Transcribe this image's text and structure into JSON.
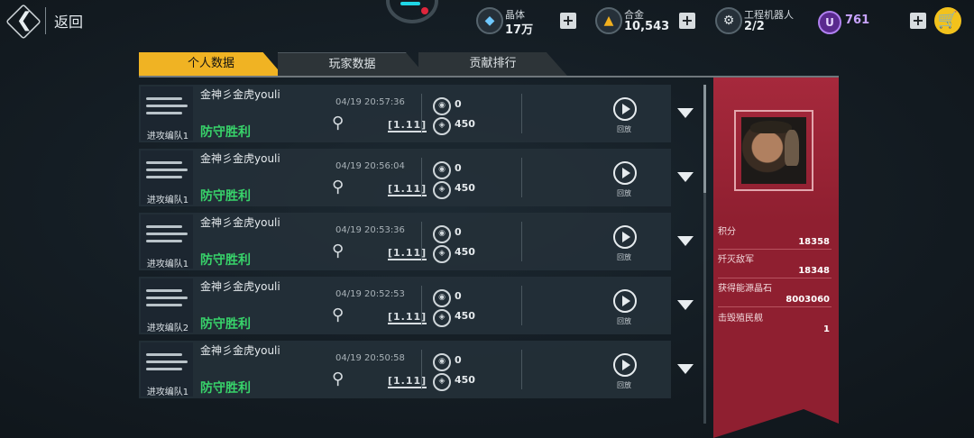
{
  "topbar": {
    "back_label": "返回",
    "resources": [
      {
        "name": "晶体",
        "value": "17万",
        "icon": "crystal-icon"
      },
      {
        "name": "合金",
        "value": "10,543",
        "icon": "alloy-icon"
      },
      {
        "name": "工程机器人",
        "value": "2/2",
        "icon": "robot-icon"
      }
    ],
    "premium_value": "761",
    "premium_icon_letter": "U"
  },
  "tabs": [
    {
      "label": "个人数据",
      "active": true
    },
    {
      "label": "玩家数据",
      "active": false
    },
    {
      "label": "贡献排行",
      "active": false
    }
  ],
  "records": [
    {
      "unit": "进攻编队1",
      "player": "金神彡金虎youli",
      "time": "04/19 20:57:36",
      "result": "防守胜利",
      "stat1": "0",
      "stat2": "450",
      "level_tag": "[1.11]",
      "replay_label": "回放"
    },
    {
      "unit": "进攻编队1",
      "player": "金神彡金虎youli",
      "time": "04/19 20:56:04",
      "result": "防守胜利",
      "stat1": "0",
      "stat2": "450",
      "level_tag": "[1.11]",
      "replay_label": "回放"
    },
    {
      "unit": "进攻编队1",
      "player": "金神彡金虎youli",
      "time": "04/19 20:53:36",
      "result": "防守胜利",
      "stat1": "0",
      "stat2": "450",
      "level_tag": "[1.11]",
      "replay_label": "回放"
    },
    {
      "unit": "进攻编队2",
      "player": "金神彡金虎youli",
      "time": "04/19 20:52:53",
      "result": "防守胜利",
      "stat1": "0",
      "stat2": "450",
      "level_tag": "[1.11]",
      "replay_label": "回放"
    },
    {
      "unit": "进攻编队1",
      "player": "金神彡金虎youli",
      "time": "04/19 20:50:58",
      "result": "防守胜利",
      "stat1": "0",
      "stat2": "450",
      "level_tag": "[1.11]",
      "replay_label": "回放"
    }
  ],
  "profile": {
    "stats": [
      {
        "label": "积分",
        "value": "18358"
      },
      {
        "label": "歼灭敌军",
        "value": "18348"
      },
      {
        "label": "获得能源晶石",
        "value": "8003060"
      },
      {
        "label": "击毁殖民舰",
        "value": "1"
      }
    ]
  },
  "colors": {
    "accent": "#f0b323",
    "victory": "#38d26a",
    "panel": "#8f1f30"
  }
}
